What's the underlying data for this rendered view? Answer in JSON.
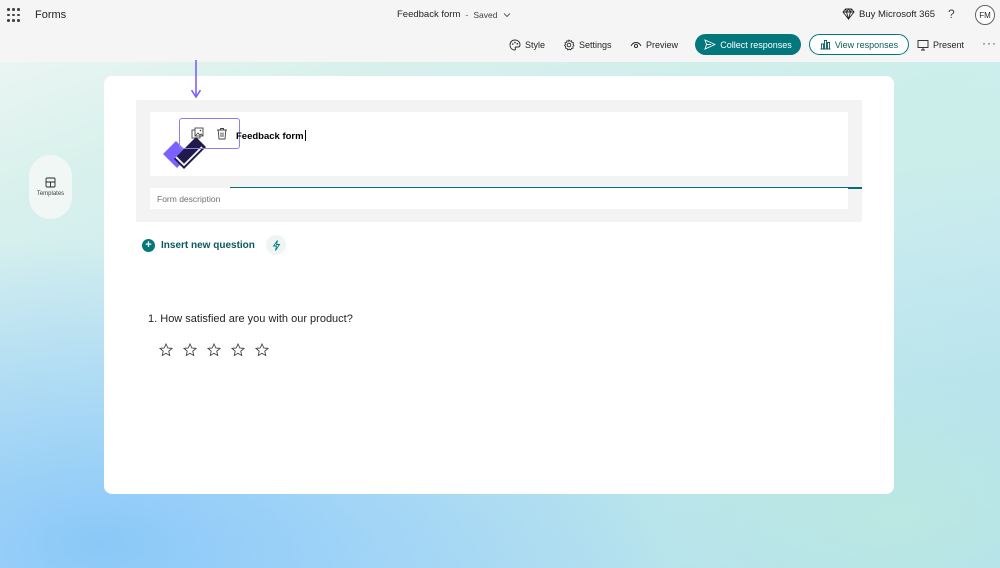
{
  "app": {
    "name": "Forms"
  },
  "document": {
    "title": "Feedback form",
    "separator": "-",
    "status": "Saved"
  },
  "header": {
    "buy_label": "Buy Microsoft 365",
    "help_label": "?",
    "avatar_initials": "FM",
    "more_label": "···"
  },
  "toolbar": {
    "style_label": "Style",
    "settings_label": "Settings",
    "preview_label": "Preview",
    "collect_label": "Collect responses",
    "view_label": "View responses",
    "present_label": "Present"
  },
  "sidebar": {
    "templates_label": "Templates"
  },
  "form": {
    "title": "Feedback form",
    "description_placeholder": "Form description",
    "insert_label": "Insert new question",
    "questions": [
      {
        "number": "1.",
        "text": "How satisfied are you with our product?",
        "type": "rating",
        "stars": 5,
        "selected": 0
      }
    ]
  },
  "colors": {
    "accent": "#03787c",
    "logo_purple": "#7b61ff",
    "logo_dark": "#1e1b4b",
    "toolbar_highlight": "#8f7fe8"
  }
}
